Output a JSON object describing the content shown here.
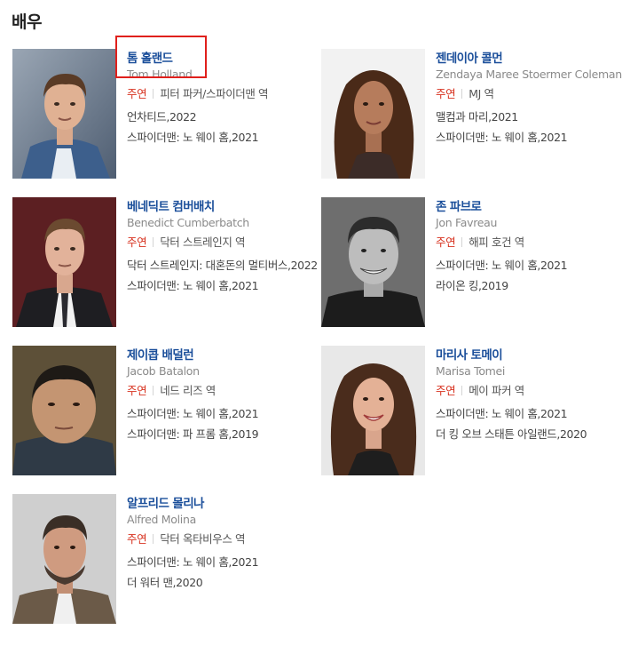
{
  "section": {
    "title": "배우"
  },
  "accent": {
    "name_color": "#1a4e9a",
    "role_color": "#d7321f",
    "highlight_color": "#e0201c"
  },
  "actors": [
    {
      "name": "톰 홀랜드",
      "eng": "Tom Holland",
      "role_type": "주연",
      "role": "피터 파커/스파이더맨 역",
      "works": [
        "언차티드,2022",
        "스파이더맨: 노 웨이 홈,2021"
      ]
    },
    {
      "name": "젠데이아 콜먼",
      "eng": "Zendaya Maree Stoermer Coleman",
      "role_type": "주연",
      "role": "MJ 역",
      "works": [
        "맬컴과 마리,2021",
        "스파이더맨: 노 웨이 홈,2021"
      ]
    },
    {
      "name": "베네딕트 컴버배치",
      "eng": "Benedict Cumberbatch",
      "role_type": "주연",
      "role": "닥터 스트레인지 역",
      "works": [
        "닥터 스트레인지: 대혼돈의 멀티버스,2022",
        "스파이더맨: 노 웨이 홈,2021"
      ]
    },
    {
      "name": "존 파브로",
      "eng": "Jon Favreau",
      "role_type": "주연",
      "role": "해피 호건 역",
      "works": [
        "스파이더맨: 노 웨이 홈,2021",
        "라이온 킹,2019"
      ]
    },
    {
      "name": "제이콥 배덜런",
      "eng": "Jacob Batalon",
      "role_type": "주연",
      "role": "네드 리즈 역",
      "works": [
        "스파이더맨: 노 웨이 홈,2021",
        "스파이더맨: 파 프롬 홈,2019"
      ]
    },
    {
      "name": "마리사 토메이",
      "eng": "Marisa Tomei",
      "role_type": "주연",
      "role": "메이 파커 역",
      "works": [
        "스파이더맨: 노 웨이 홈,2021",
        "더 킹 오브 스태튼 아일랜드,2020"
      ]
    },
    {
      "name": "알프리드 몰리나",
      "eng": "Alfred Molina",
      "role_type": "주연",
      "role": "닥터 옥타비우스 역",
      "works": [
        "스파이더맨: 노 웨이 홈,2021",
        "더 워터 맨,2020"
      ]
    }
  ]
}
